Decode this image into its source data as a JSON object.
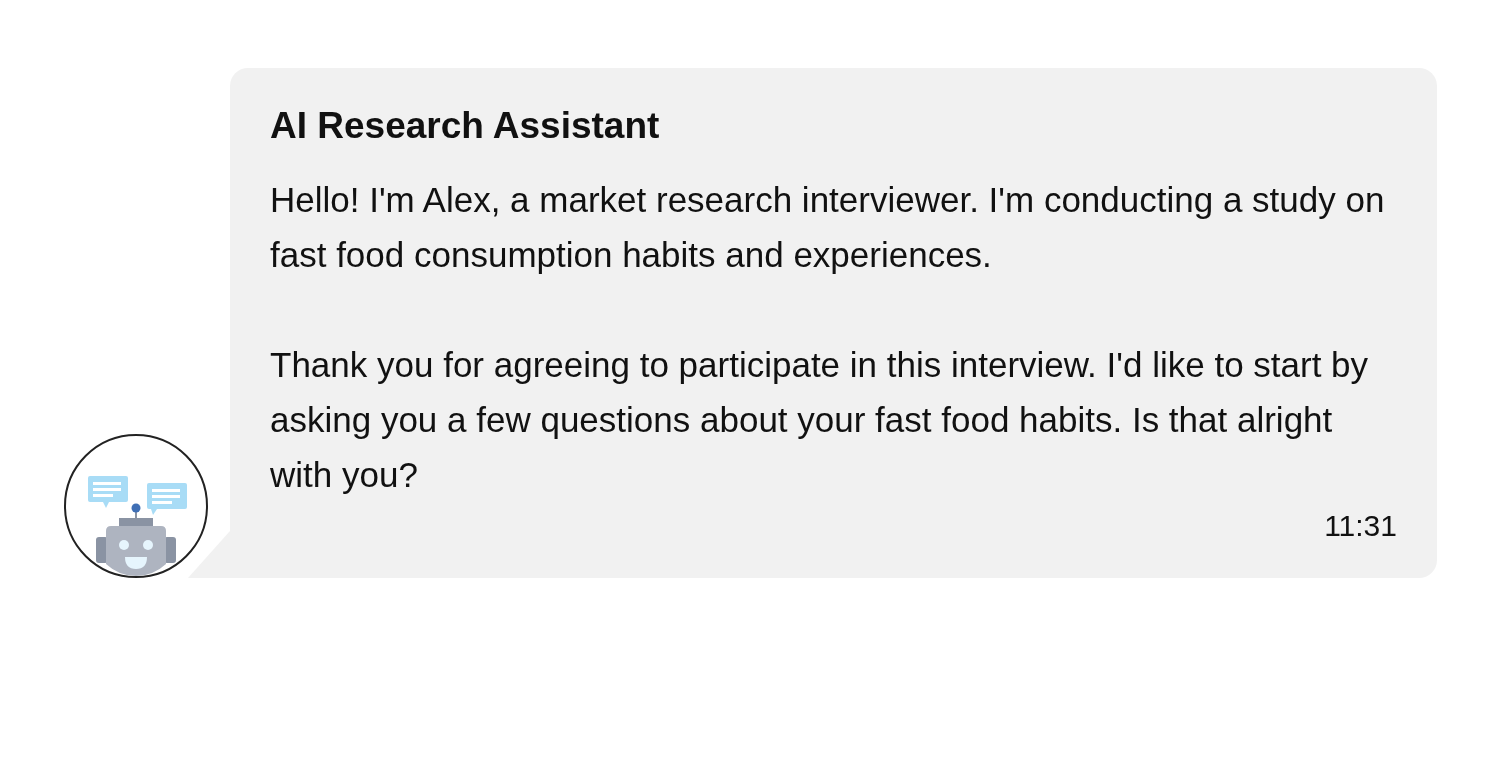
{
  "message": {
    "sender": "AI Research Assistant",
    "paragraphs": [
      "Hello! I'm Alex, a market research interviewer. I'm conducting a study on fast food consumption habits and experiences.",
      "Thank you for agreeing to participate in this interview. I'd like to start by asking you a few questions about your fast food habits. Is that alright with you?"
    ],
    "time": "11:31"
  }
}
